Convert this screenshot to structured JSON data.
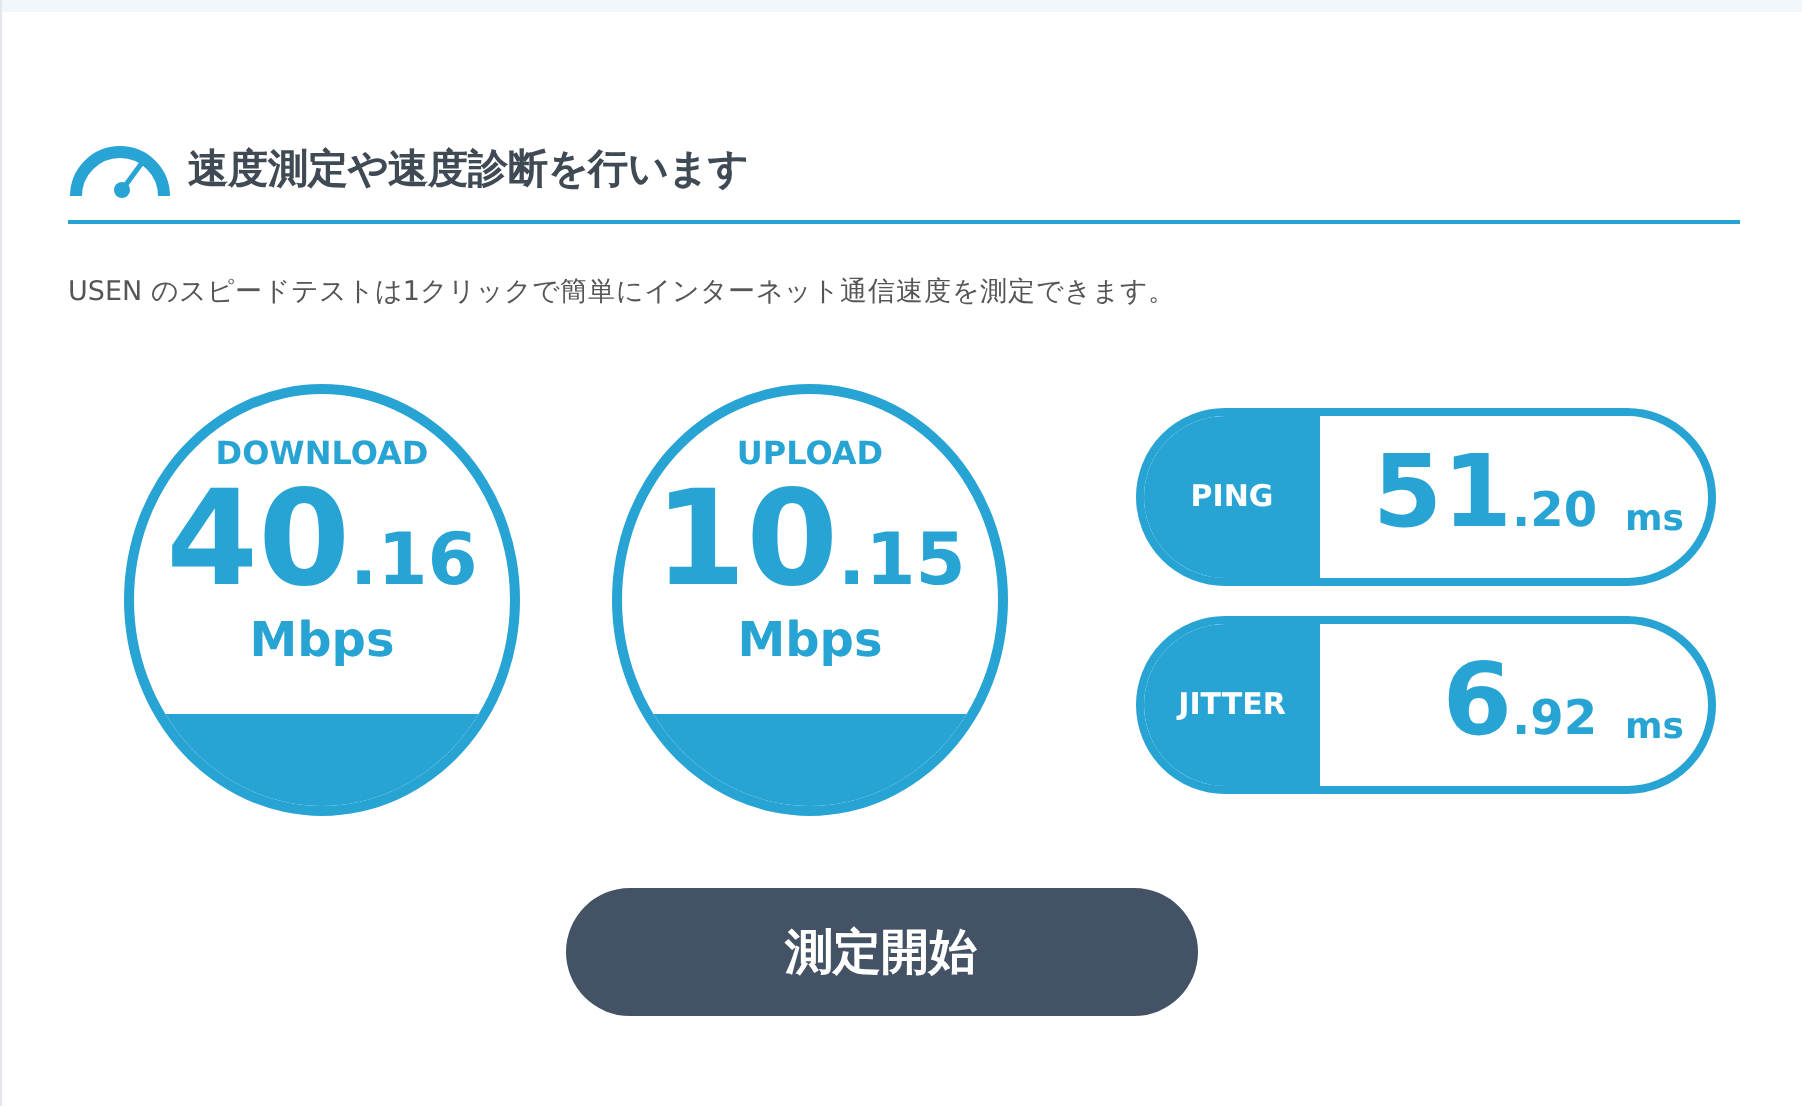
{
  "heading": {
    "title": "速度測定や速度診断を行います"
  },
  "description": "USEN のスピードテストは1クリックで簡単にインターネット通信速度を測定できます。",
  "gauges": [
    {
      "label": "DOWNLOAD",
      "integer": "40",
      "decimal": ".16",
      "unit": "Mbps"
    },
    {
      "label": "UPLOAD",
      "integer": "10",
      "decimal": ".15",
      "unit": "Mbps"
    }
  ],
  "metrics": [
    {
      "label": "PING",
      "integer": "51",
      "decimal": ".20",
      "unit": "ms"
    },
    {
      "label": "JITTER",
      "integer": "6",
      "decimal": ".92",
      "unit": "ms"
    }
  ],
  "start_button": "測定開始"
}
